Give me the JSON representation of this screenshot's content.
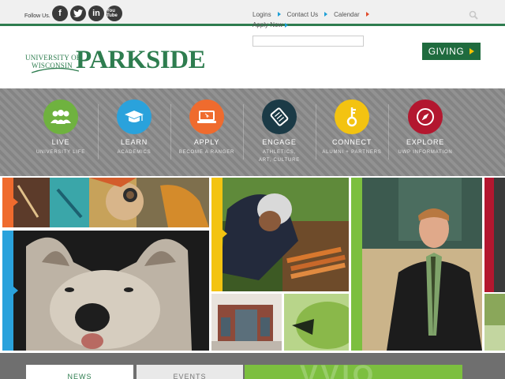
{
  "header": {
    "follow_label": "Follow Us.",
    "social": [
      "facebook",
      "twitter",
      "linkedin",
      "youtube"
    ],
    "youtube_label": "You Tube",
    "links": [
      {
        "label": "Logins",
        "marker": "blue"
      },
      {
        "label": "Contact Us",
        "marker": "blue"
      },
      {
        "label": "Calendar",
        "marker": "red"
      }
    ],
    "apply_now": "Apply Now",
    "search_placeholder": "",
    "logo_line1": "UNIVERSITY OF",
    "logo_line2": "WISCONSIN",
    "logo_name": "PARKSIDE",
    "giving_label": "GIVING"
  },
  "nav": [
    {
      "title": "LIVE",
      "sub": "UNIVERSITY LIFE",
      "color": "#6fb23f",
      "icon": "people-icon"
    },
    {
      "title": "LEARN",
      "sub": "ACADEMICS",
      "color": "#2aa2dc",
      "icon": "graduation-cap-icon"
    },
    {
      "title": "APPLY",
      "sub": "BECOME A RANGER",
      "color": "#ef6b2e",
      "icon": "laptop-icon"
    },
    {
      "title": "ENGAGE",
      "sub": "ATHLETICS, ART, CULTURE",
      "color": "#1b3a46",
      "icon": "ticket-icon"
    },
    {
      "title": "CONNECT",
      "sub": "ALUMNI + PARTNERS",
      "color": "#f3c311",
      "icon": "key-icon"
    },
    {
      "title": "EXPLORE",
      "sub": "UWP INFORMATION",
      "color": "#b3172f",
      "icon": "compass-icon"
    }
  ],
  "tabs": {
    "news": "NEWS",
    "events": "EVENTS"
  },
  "colors": {
    "brand_green": "#2e7d4f",
    "giving_green": "#1f6b3e",
    "accent_orange": "#ef6b2e",
    "accent_blue": "#2aa2dc",
    "accent_yellow": "#f3c311",
    "accent_green": "#7cbf3f",
    "accent_red": "#b3172f"
  }
}
